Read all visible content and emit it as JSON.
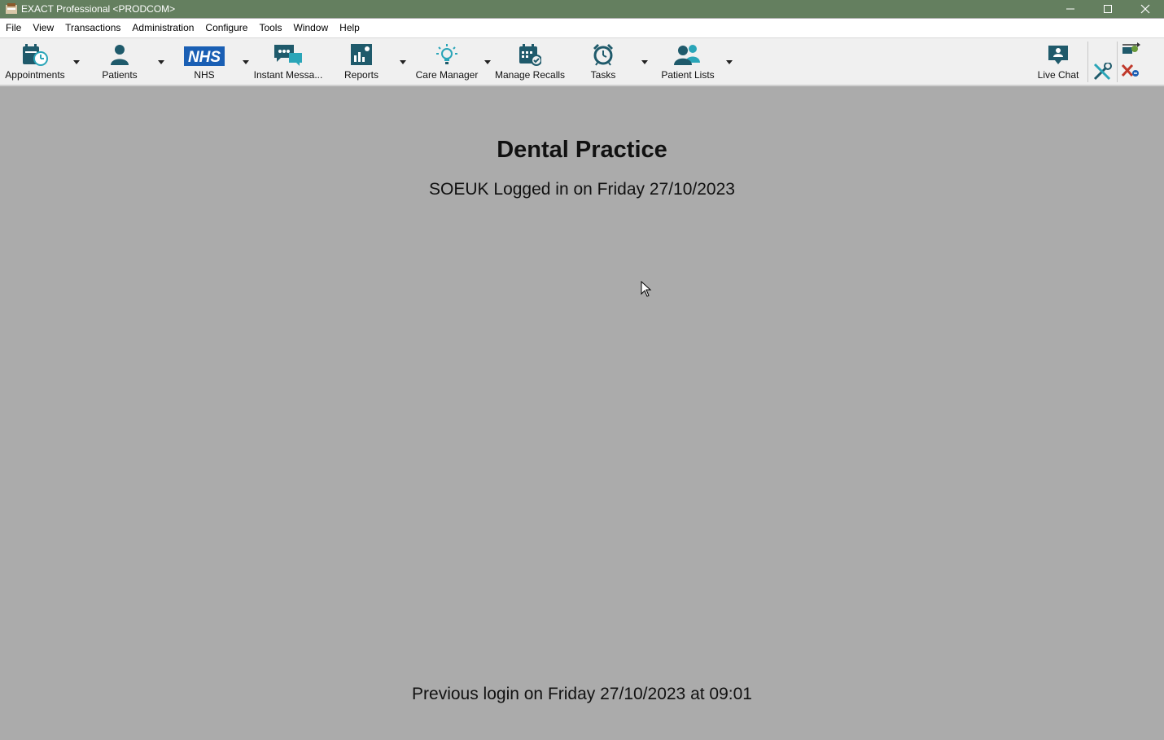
{
  "window": {
    "title": "EXACT Professional <PRODCOM>"
  },
  "menu": [
    "File",
    "View",
    "Transactions",
    "Administration",
    "Configure",
    "Tools",
    "Window",
    "Help"
  ],
  "toolbar": {
    "appointments": "Appointments",
    "patients": "Patients",
    "nhs": "NHS",
    "nhs_logo_text": "NHS",
    "instant_messages": "Instant Messa...",
    "reports": "Reports",
    "care_manager": "Care Manager",
    "manage_recalls": "Manage Recalls",
    "tasks": "Tasks",
    "patient_lists": "Patient Lists",
    "live_chat": "Live Chat"
  },
  "main": {
    "practice_name": "Dental Practice",
    "login_line": "SOEUK Logged in on Friday 27/10/2023",
    "previous_login": "Previous login on Friday 27/10/2023 at 09:01"
  },
  "colors": {
    "titlebar": "#647f5f",
    "icon_teal": "#1f5a6b",
    "nhs_blue": "#1a5fb4",
    "workspace": "#ababab"
  }
}
